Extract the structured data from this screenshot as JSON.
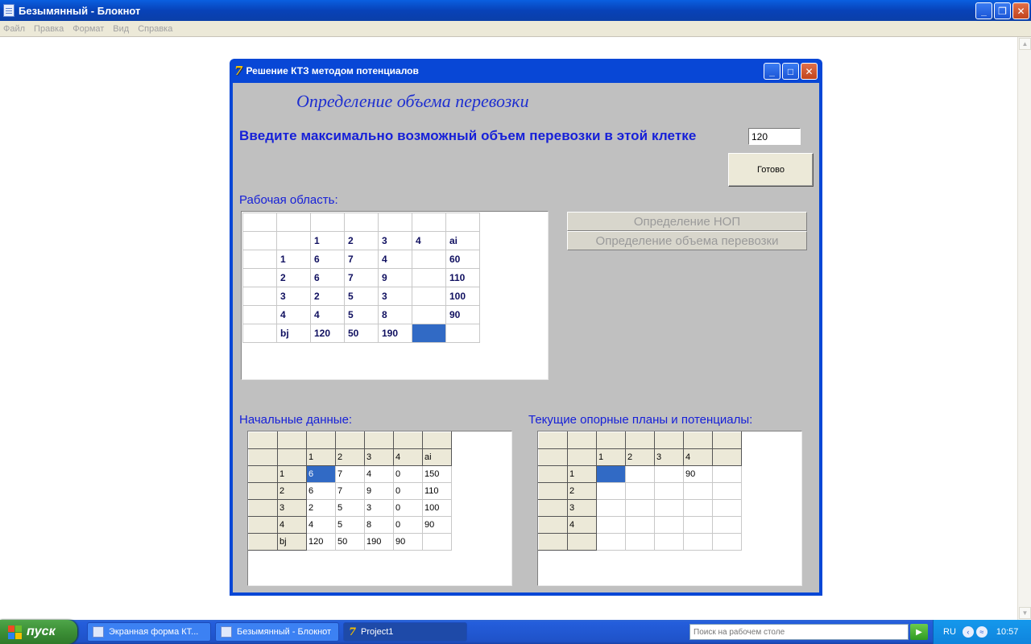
{
  "notepad": {
    "title": "Безымянный - Блокнот",
    "menu": [
      "Файл",
      "Правка",
      "Формат",
      "Вид",
      "Справка"
    ]
  },
  "app": {
    "title": "Решение КТЗ методом потенциалов",
    "heading": "Определение объема перевозки",
    "prompt": "Введите максимально возможный объем перевозки в этой клетке",
    "input_value": "120",
    "ready_button": "Готово",
    "work_label": "Рабочая область:",
    "btn_nop": "Определение НОП",
    "btn_volume": "Определение объема перевозки",
    "initial_label": "Начальные данные:",
    "current_label": "Текущие опорные планы и потенциалы:",
    "work_grid": [
      [
        "",
        "",
        "",
        "",
        "",
        "",
        ""
      ],
      [
        "",
        "",
        "1",
        "2",
        "3",
        "4",
        "ai"
      ],
      [
        "",
        "1",
        "6",
        "7",
        "4",
        "",
        "60"
      ],
      [
        "",
        "2",
        "6",
        "7",
        "9",
        "",
        "110"
      ],
      [
        "",
        "3",
        "2",
        "5",
        "3",
        "",
        "100"
      ],
      [
        "",
        "4",
        "4",
        "5",
        "8",
        "",
        "90"
      ],
      [
        "",
        "bj",
        "120",
        "50",
        "190",
        "",
        ""
      ]
    ],
    "initial_grid": [
      [
        "",
        "",
        "",
        "",
        "",
        "",
        ""
      ],
      [
        "",
        "",
        "1",
        "2",
        "3",
        "4",
        "ai"
      ],
      [
        "",
        "1",
        "6",
        "7",
        "4",
        "0",
        "150"
      ],
      [
        "",
        "2",
        "6",
        "7",
        "9",
        "0",
        "110"
      ],
      [
        "",
        "3",
        "2",
        "5",
        "3",
        "0",
        "100"
      ],
      [
        "",
        "4",
        "4",
        "5",
        "8",
        "0",
        "90"
      ],
      [
        "",
        "bj",
        "120",
        "50",
        "190",
        "90",
        ""
      ]
    ],
    "current_grid": [
      [
        "",
        "",
        "",
        "",
        "",
        "",
        ""
      ],
      [
        "",
        "",
        "1",
        "2",
        "3",
        "4",
        ""
      ],
      [
        "",
        "1",
        "",
        "",
        "",
        "90",
        ""
      ],
      [
        "",
        "2",
        "",
        "",
        "",
        "",
        ""
      ],
      [
        "",
        "3",
        "",
        "",
        "",
        "",
        ""
      ],
      [
        "",
        "4",
        "",
        "",
        "",
        "",
        ""
      ],
      [
        "",
        "",
        "",
        "",
        "",
        "",
        ""
      ]
    ]
  },
  "taskbar": {
    "start": "пуск",
    "tasks": [
      "Экранная форма КТ...",
      "Безымянный - Блокнот",
      "Project1"
    ],
    "search_placeholder": "Поиск на рабочем столе",
    "lang": "RU",
    "clock": "10:57"
  }
}
